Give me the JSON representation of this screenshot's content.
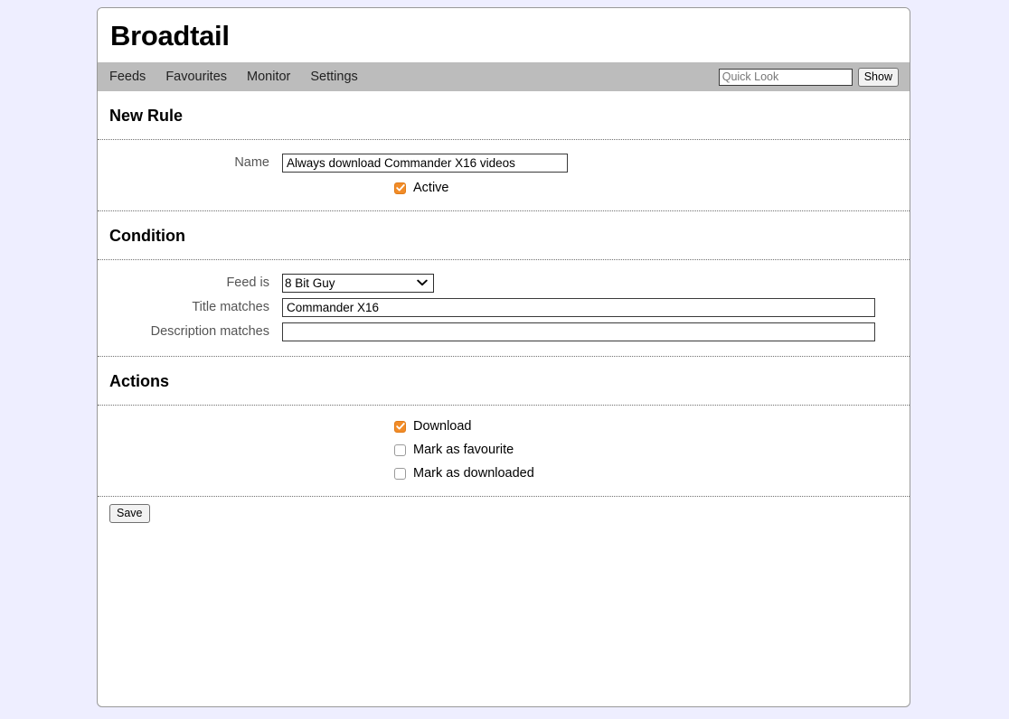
{
  "app": {
    "title": "Broadtail"
  },
  "nav": {
    "items": [
      {
        "label": "Feeds"
      },
      {
        "label": "Favourites"
      },
      {
        "label": "Monitor"
      },
      {
        "label": "Settings"
      }
    ],
    "quick_look": {
      "value": "",
      "placeholder": "Quick Look"
    },
    "show_label": "Show"
  },
  "sections": {
    "new_rule": {
      "heading": "New Rule",
      "name_label": "Name",
      "name_value": "Always download Commander X16 videos",
      "active_label": "Active",
      "active_checked": true
    },
    "condition": {
      "heading": "Condition",
      "feed_label": "Feed is",
      "feed_value": "8 Bit Guy",
      "feed_options": [
        "8 Bit Guy"
      ],
      "title_label": "Title matches",
      "title_value": "Commander X16",
      "description_label": "Description matches",
      "description_value": ""
    },
    "actions": {
      "heading": "Actions",
      "items": [
        {
          "label": "Download",
          "checked": true
        },
        {
          "label": "Mark as favourite",
          "checked": false
        },
        {
          "label": "Mark as downloaded",
          "checked": false
        }
      ]
    }
  },
  "footer": {
    "save_label": "Save"
  },
  "colors": {
    "accent": "#f28c28",
    "navbar": "#bcbcbc",
    "page_background": "#eeeeff",
    "label_text": "#555555"
  }
}
